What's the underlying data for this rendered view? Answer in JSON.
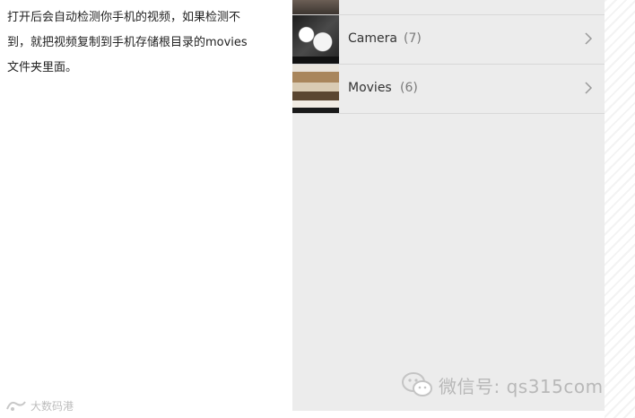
{
  "article": {
    "text": "打开后会自动检测你手机的视频，如果检测不到，就把视频复制到手机存储根目录的movies文件夹里面。"
  },
  "folders": [
    {
      "name": "",
      "count": ""
    },
    {
      "name": "Camera",
      "count": "(7)"
    },
    {
      "name": "Movies",
      "count": "(6)"
    }
  ],
  "watermarks": {
    "wechat": "微信号: qs315com",
    "logo": "大数码港"
  },
  "icons": {
    "chevron": "chevron-right-icon",
    "wechat": "wechat-icon"
  },
  "colors": {
    "panel_bg": "#ececec",
    "text": "#333333",
    "count": "#7a7a7a",
    "divider": "#d8d8d8"
  }
}
